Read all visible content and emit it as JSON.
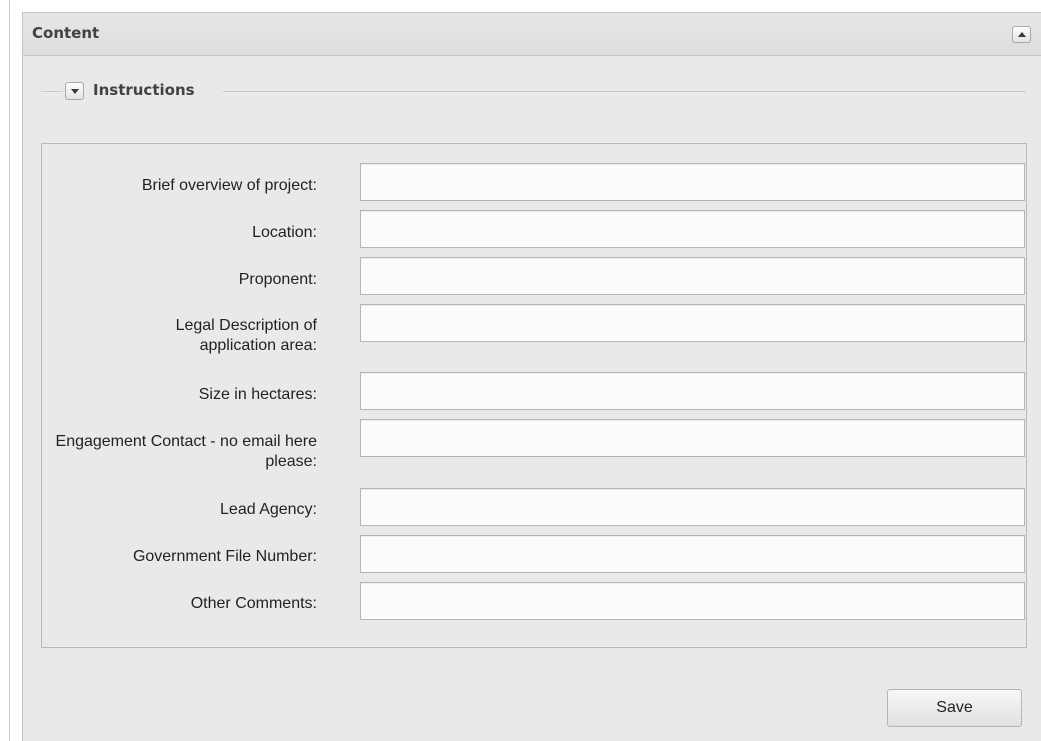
{
  "panel": {
    "title": "Content"
  },
  "fieldset": {
    "legend": "Instructions"
  },
  "form": {
    "fields": [
      {
        "label": "Brief overview of project:",
        "value": "",
        "placeholder": ""
      },
      {
        "label": "Location:",
        "value": "",
        "placeholder": ""
      },
      {
        "label": "Proponent:",
        "value": "",
        "placeholder": ""
      },
      {
        "label": "Legal Description of application area:",
        "value": "",
        "placeholder": ""
      },
      {
        "label": "Size in hectares:",
        "value": "",
        "placeholder": ""
      },
      {
        "label": "Engagement Contact - no email here please:",
        "value": "",
        "placeholder": ""
      },
      {
        "label": "Lead Agency:",
        "value": "",
        "placeholder": ""
      },
      {
        "label": "Government File Number:",
        "value": "",
        "placeholder": ""
      },
      {
        "label": "Other Comments:",
        "value": "",
        "placeholder": ""
      }
    ]
  },
  "footer": {
    "save_label": "Save"
  },
  "icons": {
    "collapse": "chevron-up-icon",
    "legend_toggle": "chevron-down-icon"
  }
}
